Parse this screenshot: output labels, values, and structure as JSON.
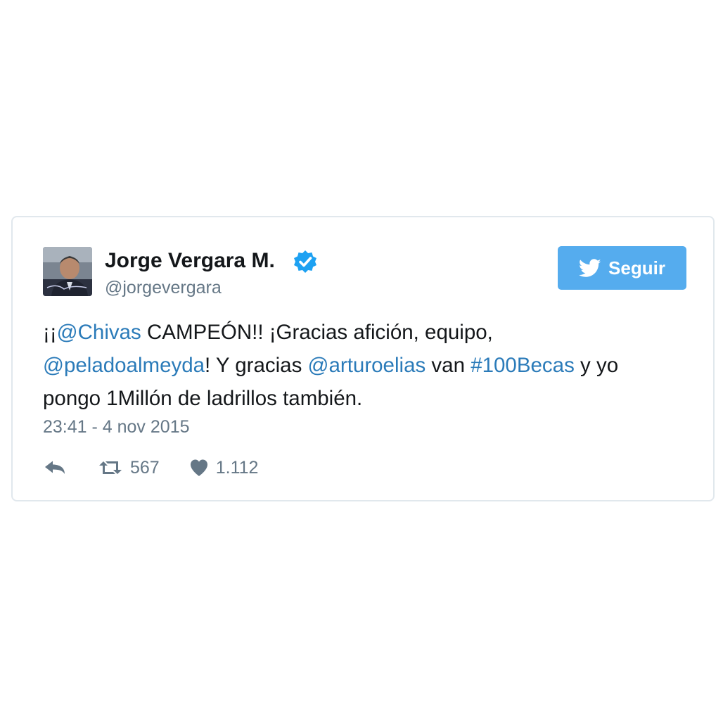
{
  "author": {
    "name": "Jorge Vergara M.",
    "handle": "@jorgevergara",
    "verified": true,
    "avatar_icon": "profile-photo"
  },
  "follow_button": {
    "label": "Seguir",
    "icon": "twitter-bird-icon",
    "color": "#55acee"
  },
  "tweet": {
    "lines": [
      [
        {
          "text": "¡¡",
          "type": "text"
        },
        {
          "text": "@Chivas",
          "type": "mention"
        },
        {
          "text": " CAMPEÓN!! ¡Gracias afición, equipo,",
          "type": "text"
        }
      ],
      [
        {
          "text": "@peladoalmeyda",
          "type": "mention"
        },
        {
          "text": "! Y gracias ",
          "type": "text"
        },
        {
          "text": "@arturoelias",
          "type": "mention"
        },
        {
          "text": " van ",
          "type": "text"
        },
        {
          "text": "#100Becas",
          "type": "hashtag"
        },
        {
          "text": " y yo",
          "type": "text"
        }
      ],
      [
        {
          "text": "pongo 1Millón de ladrillos también.",
          "type": "text"
        }
      ]
    ],
    "timestamp": "23:41 - 4 nov 2015"
  },
  "actions": {
    "reply_icon": "reply-icon",
    "retweet_icon": "retweet-icon",
    "retweet_count": "567",
    "like_icon": "heart-icon",
    "like_count": "1.112"
  },
  "colors": {
    "link": "#2b7bb9",
    "muted": "#657786",
    "text": "#14171a",
    "border": "#e1e8ed"
  }
}
